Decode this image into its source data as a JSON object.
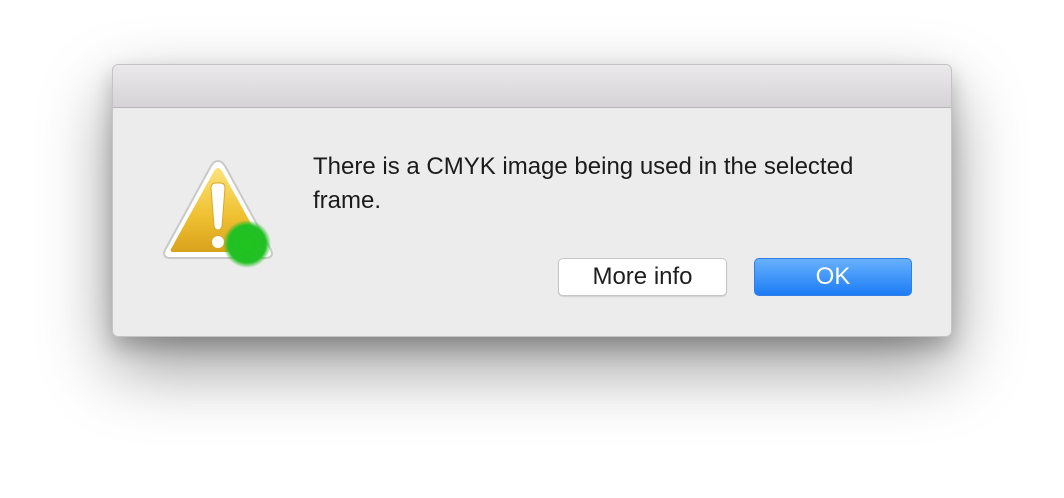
{
  "alert": {
    "message": "There is a CMYK image being used in the selected frame.",
    "icon": "warning-icon",
    "badge_icon": "green-dot-badge-icon"
  },
  "buttons": {
    "more_info_label": "More info",
    "ok_label": "OK"
  },
  "colors": {
    "accent_blue": "#1c7cf6",
    "warning_yellow": "#f0c233",
    "badge_green": "#1fc41f",
    "dialog_background": "#ececec"
  }
}
